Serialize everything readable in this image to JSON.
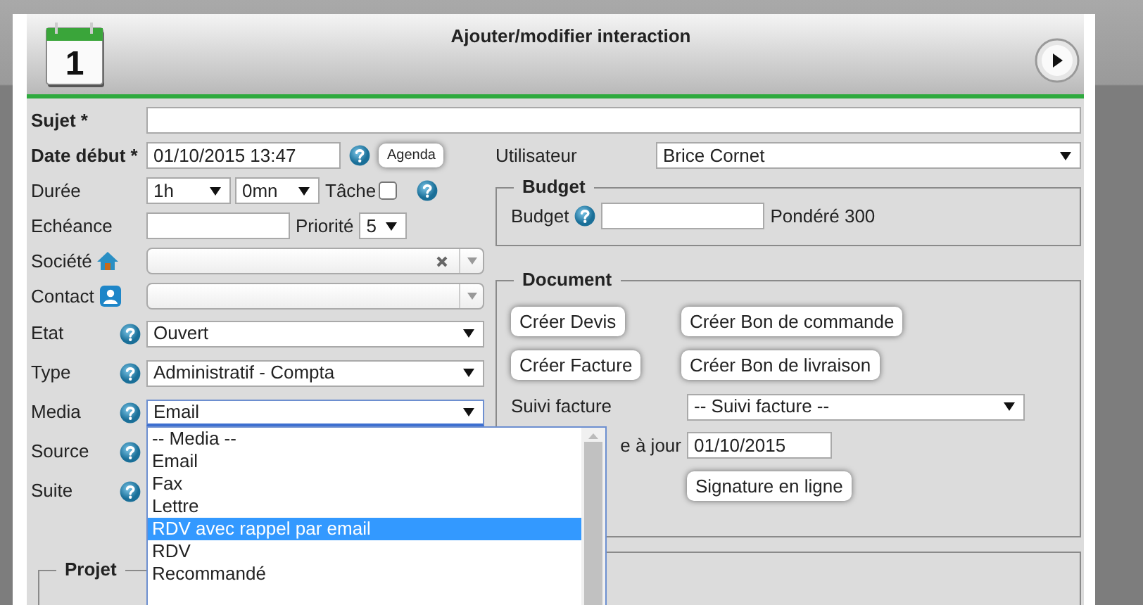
{
  "dialog": {
    "title": "Ajouter/modifier interaction",
    "calendar_day": "1"
  },
  "subject": {
    "label": "Sujet *",
    "bold": true
  },
  "left_rows": [
    {
      "kind": "date",
      "label": "Date début *",
      "bold": true,
      "value": "01/10/2015 13:47",
      "help": true,
      "button": "Agenda"
    },
    {
      "kind": "duration",
      "label": "Durée",
      "hours": "1h",
      "minutes": "0mn",
      "task_label": "Tâche",
      "task_checked": false,
      "help": true
    },
    {
      "kind": "due",
      "label": "Echéance",
      "priority_label": "Priorité",
      "priority": "5"
    },
    {
      "kind": "company",
      "label": "Société",
      "clearable": true
    },
    {
      "kind": "contact",
      "label": "Contact",
      "clearable": false
    },
    {
      "kind": "select",
      "label": "Etat",
      "help": true,
      "value": "Ouvert",
      "focused": false
    },
    {
      "kind": "select",
      "label": "Type",
      "help": true,
      "value": "Administratif - Compta",
      "focused": false
    },
    {
      "kind": "select",
      "label": "Media",
      "help": true,
      "value": "Email",
      "focused": true,
      "open": true
    },
    {
      "kind": "label",
      "label": "Source",
      "help": true
    },
    {
      "kind": "label",
      "label": "Suite",
      "help": true
    }
  ],
  "media_options": [
    {
      "label": "-- Media --",
      "selected": false
    },
    {
      "label": "Email",
      "selected": false
    },
    {
      "label": "Fax",
      "selected": false
    },
    {
      "label": "Lettre",
      "selected": false
    },
    {
      "label": "RDV avec rappel par email",
      "selected": true
    },
    {
      "label": "RDV",
      "selected": false
    },
    {
      "label": "Recommandé",
      "selected": false
    }
  ],
  "user": {
    "label": "Utilisateur",
    "value": "Brice Cornet"
  },
  "budget": {
    "legend": "Budget",
    "label": "Budget",
    "help": true,
    "note": "Pondéré 300"
  },
  "document": {
    "legend": "Document",
    "buttons": [
      [
        "Créer Devis",
        "Créer Bon de commande"
      ],
      [
        "Créer Facture",
        "Créer Bon de livraison"
      ]
    ],
    "follow_up": {
      "label": "Suivi facture",
      "value": "-- Suivi facture --"
    },
    "update": {
      "label": "e à jour",
      "value": "01/10/2015"
    },
    "signature": "Signature en ligne"
  },
  "project": {
    "legend": "Projet"
  }
}
